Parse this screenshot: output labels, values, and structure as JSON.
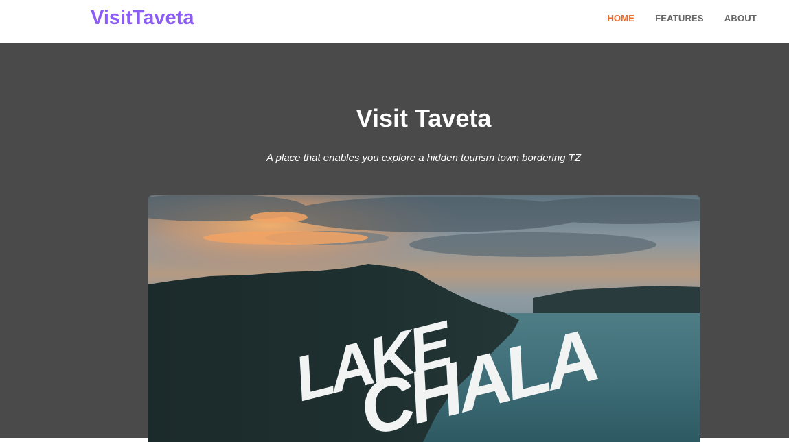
{
  "brand": {
    "name": "VisitTaveta",
    "color": "#8b5cf6"
  },
  "nav": {
    "items": [
      {
        "label": "HOME",
        "active": true
      },
      {
        "label": "FEATURES",
        "active": false
      },
      {
        "label": "ABOUT",
        "active": false
      }
    ],
    "active_color": "#e8692a"
  },
  "hero": {
    "title": "Visit Taveta",
    "subtitle": "A place that enables you explore a hidden tourism town bordering TZ",
    "image": {
      "overlay_text": [
        "LAKE",
        "CHALA"
      ]
    }
  }
}
